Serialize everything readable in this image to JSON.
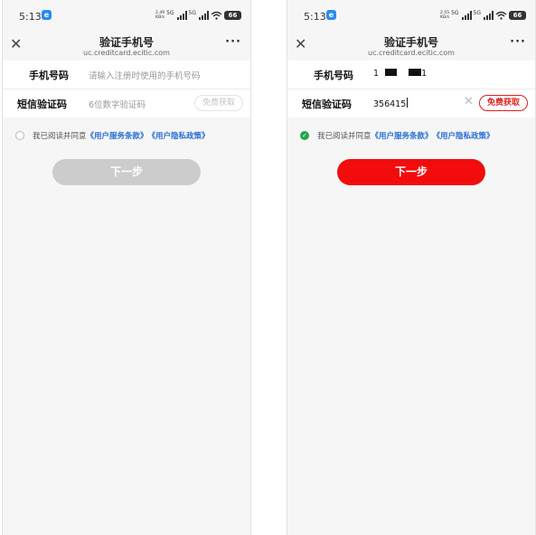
{
  "screens": [
    {
      "status": {
        "time": "5:13",
        "net_speed": "2.49\nKB/s",
        "signal": "5G",
        "battery": "66"
      },
      "header": {
        "title": "验证手机号",
        "subtitle": "uc.creditcard.ecitic.com"
      },
      "form": {
        "phone_label": "手机号码",
        "phone_placeholder": "请输入注册时使用的手机号码",
        "code_label": "短信验证码",
        "code_placeholder": "6位数字验证码",
        "code_button": "免费获取"
      },
      "agreement": {
        "prefix": "我已阅读并同意",
        "terms": "《用户服务条款》",
        "privacy": "《用户隐私政策》",
        "checked": false
      },
      "next_button": "下一步"
    },
    {
      "status": {
        "time": "5:13",
        "net_speed": "2.55\nKB/s",
        "signal": "5G",
        "battery": "66"
      },
      "header": {
        "title": "验证手机号",
        "subtitle": "uc.creditcard.ecitic.com"
      },
      "form": {
        "phone_label": "手机号码",
        "phone_first": "1",
        "phone_last": "1",
        "code_label": "短信验证码",
        "code_value": "356415",
        "code_button": "免费获取"
      },
      "agreement": {
        "prefix": "我已阅读并同意",
        "terms": "《用户服务条款》",
        "privacy": "《用户隐私政策》",
        "checked": true
      },
      "next_button": "下一步"
    }
  ],
  "colors": {
    "accent_red": "#f20c0c",
    "disabled_gray": "#cccccc",
    "link_blue": "#2a6fd6",
    "check_green": "#22a649"
  },
  "icons": [
    "close-icon",
    "more-icon",
    "clear-icon",
    "checkbox-icon",
    "signal-icon",
    "wifi-icon",
    "battery-icon"
  ]
}
